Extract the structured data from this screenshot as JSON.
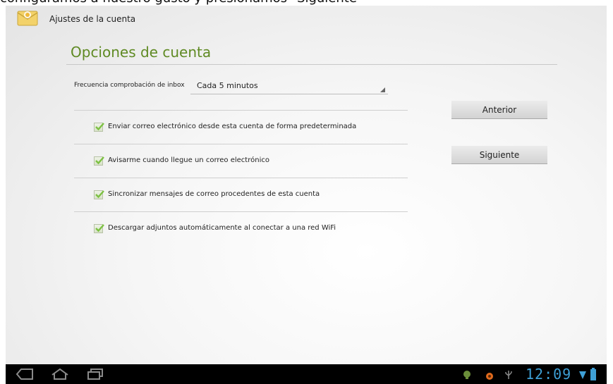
{
  "caption": "configuramos a nuestro gusto y presionamos \"Siguiente\"",
  "app": {
    "icon": "email-envelope-icon",
    "title": "Ajustes de la cuenta"
  },
  "section": {
    "title": "Opciones de cuenta"
  },
  "inbox_frequency": {
    "label": "Frecuencia comprobación de inbox",
    "value": "Cada 5 minutos"
  },
  "options": [
    {
      "label": "Enviar correo electrónico desde esta cuenta de forma predeterminada",
      "checked": true
    },
    {
      "label": "Avisarme cuando llegue un correo electrónico",
      "checked": true
    },
    {
      "label": "Sincronizar mensajes de correo procedentes de esta cuenta",
      "checked": true
    },
    {
      "label": "Descargar adjuntos automáticamente al conectar a una red WiFi",
      "checked": true
    }
  ],
  "buttons": {
    "previous": "Anterior",
    "next": "Siguiente"
  },
  "system_bar": {
    "time": "12:09",
    "icons": [
      "back-icon",
      "home-icon",
      "recent-apps-icon",
      "android-debug-icon",
      "notification-icon",
      "usb-icon",
      "wifi-icon",
      "battery-icon"
    ]
  },
  "colors": {
    "accent": "#5f8a23",
    "checkmark": "#7cc142",
    "nav_background": "#000000",
    "clock": "#3ea0d6"
  }
}
